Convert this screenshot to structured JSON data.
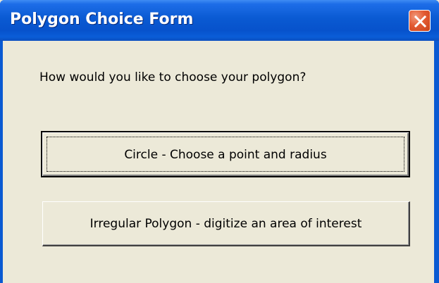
{
  "window": {
    "title": "Polygon Choice Form",
    "close_icon": "close-icon",
    "accent_color": "#0a5ad2",
    "close_color": "#e35b32"
  },
  "dialog": {
    "prompt": "How would you like to choose your polygon?",
    "buttons": [
      {
        "label": "Circle - Choose a point and radius",
        "focused": true
      },
      {
        "label": "Irregular Polygon - digitize an area of interest",
        "focused": false
      }
    ]
  }
}
